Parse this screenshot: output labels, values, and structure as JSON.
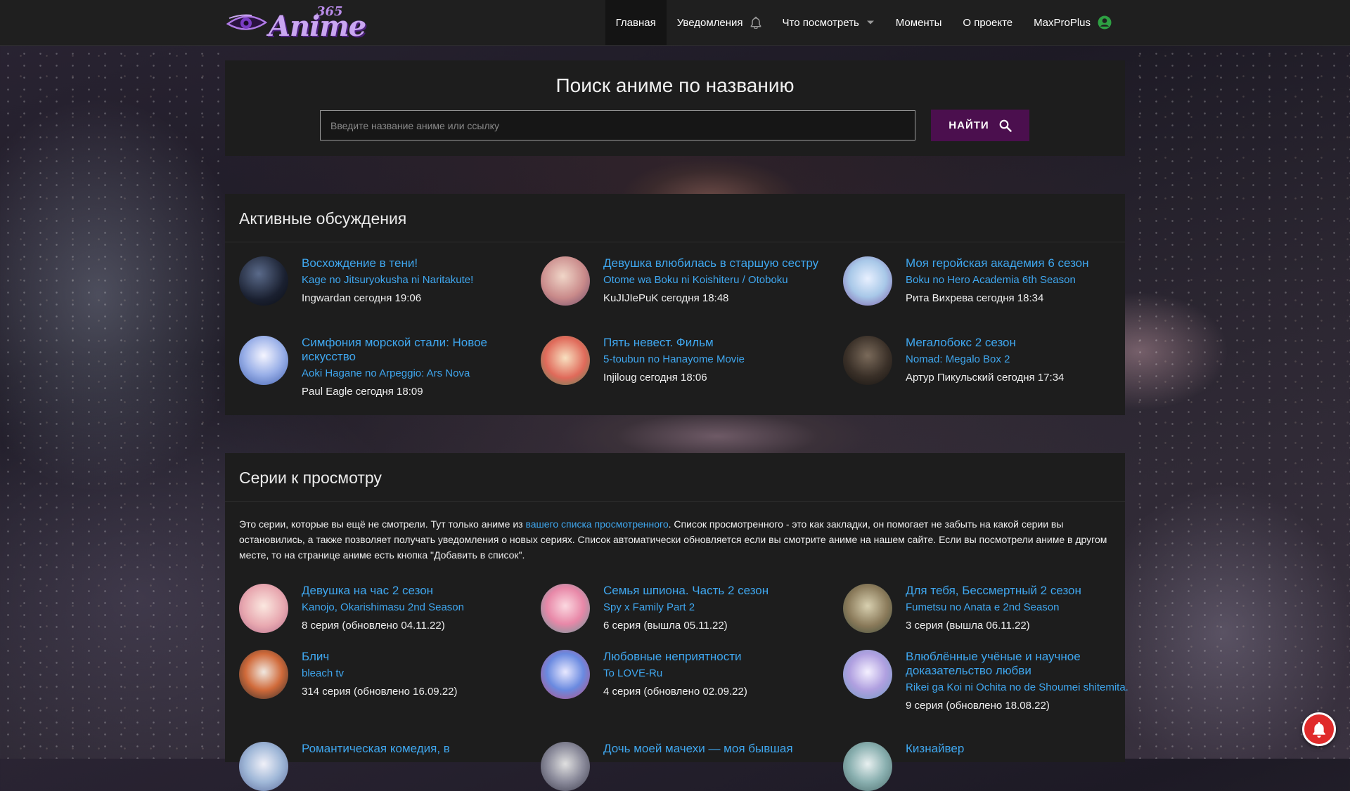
{
  "logo": {
    "word": "Anime",
    "number": "365"
  },
  "nav": {
    "items": [
      {
        "label": "Главная"
      },
      {
        "label": "Уведомления"
      },
      {
        "label": "Что посмотреть"
      },
      {
        "label": "Моменты"
      },
      {
        "label": "О проекте"
      },
      {
        "label": "MaxProPlus"
      }
    ]
  },
  "search": {
    "title": "Поиск аниме по названию",
    "placeholder": "Введите название аниме или ссылку",
    "button": "НАЙТИ"
  },
  "discussions": {
    "title": "Активные обсуждения",
    "items": [
      {
        "title": "Восхождение в тени!",
        "sub": "Kage no Jitsuryokusha ni Naritakute!",
        "meta": "Ingwardan сегодня 19:06"
      },
      {
        "title": "Девушка влюбилась в старшую сестру",
        "sub": "Otome wa Boku ni Koishiteru / Otoboku",
        "meta": "KuJIJIePuK сегодня 18:48"
      },
      {
        "title": "Моя геройская академия 6 сезон",
        "sub": "Boku no Hero Academia 6th Season",
        "meta": "Рита Вихрева сегодня 18:34"
      },
      {
        "title": "Симфония морской стали: Новое искусство",
        "sub": "Aoki Hagane no Arpeggio: Ars Nova",
        "meta": "Paul Eagle сегодня 18:09"
      },
      {
        "title": "Пять невест. Фильм",
        "sub": "5-toubun no Hanayome Movie",
        "meta": "Injiloug сегодня 18:06"
      },
      {
        "title": "Мегалобокс 2 сезон",
        "sub": "Nomad: Megalo Box 2",
        "meta": "Артур Пикульский сегодня 17:34"
      }
    ]
  },
  "episodes": {
    "title": "Серии к просмотру",
    "desc_before": "Это серии, которые вы ещё не смотрели. Тут только аниме из ",
    "desc_link": "вашего списка просмотренного",
    "desc_after": ". Список просмотренного - это как закладки, он помогает не забыть на какой серии вы остановились, а также позволяет получать уведомления о новых сериях. Список автоматически обновляется если вы смотрите аниме на нашем сайте. Если вы посмотрели аниме в другом месте, то на странице аниме есть кнопка \"Добавить в список\".",
    "items": [
      {
        "title": "Девушка на час 2 сезон",
        "sub": "Kanojo, Okarishimasu 2nd Season",
        "meta": "8 серия (обновлено 04.11.22)"
      },
      {
        "title": "Семья шпиона. Часть 2 сезон",
        "sub": "Spy x Family Part 2",
        "meta": "6 серия (вышла 05.11.22)"
      },
      {
        "title": "Для тебя, Бессмертный 2 сезон",
        "sub": "Fumetsu no Anata e 2nd Season",
        "meta": "3 серия (вышла 06.11.22)"
      },
      {
        "title": "Блич",
        "sub": "bleach tv",
        "meta": "314 серия (обновлено 16.09.22)"
      },
      {
        "title": "Любовные неприятности",
        "sub": "To LOVE-Ru",
        "meta": "4 серия (обновлено 02.09.22)"
      },
      {
        "title": "Влюблённые учёные и научное доказательство любви",
        "sub": "Rikei ga Koi ni Ochita no de Shoumei shitemita.",
        "meta": "9 серия (обновлено 18.08.22)"
      },
      {
        "title": "Романтическая комедия, в",
        "sub": "",
        "meta": ""
      },
      {
        "title": "Дочь моей мачехи — моя бывшая",
        "sub": "",
        "meta": ""
      },
      {
        "title": "Кизнайвер",
        "sub": "",
        "meta": ""
      }
    ]
  },
  "colors": {
    "accent": "#3fa7ef",
    "button": "#4b0f4e",
    "panel": "#1d1d1d",
    "header": "#1f1f1f",
    "user_icon": "#2ea043",
    "notify": "#e02b2b"
  }
}
